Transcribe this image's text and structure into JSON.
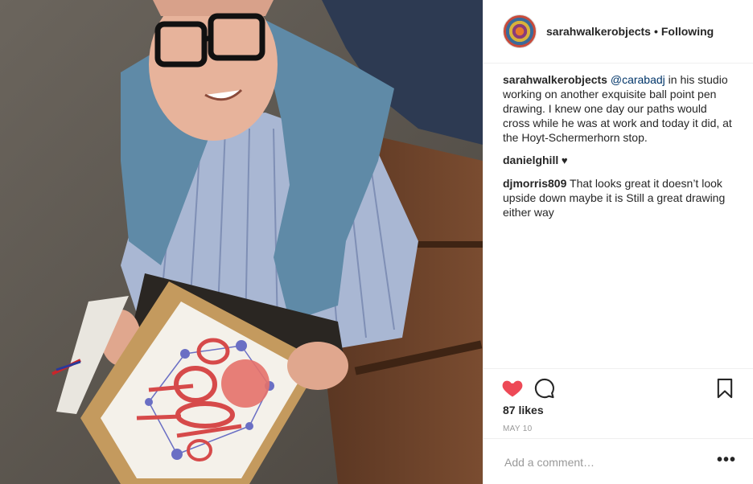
{
  "header": {
    "username": "sarahwalkerobjects",
    "separator": "•",
    "follow_status": "Following"
  },
  "comments": [
    {
      "username": "sarahwalkerobjects",
      "mention": "@carabadj",
      "text": " in his studio working on another exquisite ball point pen drawing. I knew one day our paths would cross while he was at work and today it did, at the Hoyt-Schermerhorn stop."
    },
    {
      "username": "danielghill",
      "text": " ♥"
    },
    {
      "username": "djmorris809",
      "text": " That looks great it doesn’t look upside down maybe it is Still a great drawing either way"
    }
  ],
  "actions": {
    "like_icon": "heart-icon",
    "comment_icon": "comment-icon",
    "save_icon": "bookmark-icon",
    "liked": true,
    "like_color": "#ed4956"
  },
  "likes": "87 likes",
  "date": "MAY 10",
  "add_comment": {
    "placeholder": "Add a comment…",
    "more_label": "•••"
  }
}
